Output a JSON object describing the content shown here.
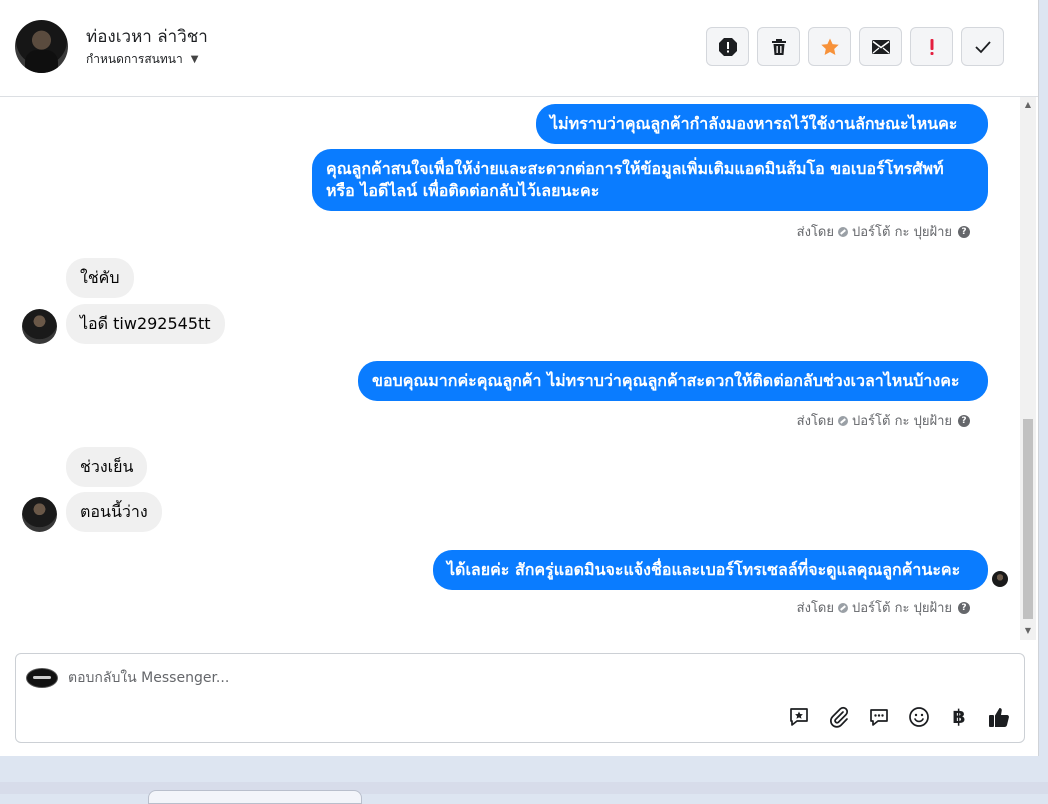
{
  "header": {
    "contact_name": "ท่องเวหา ล่าวิชา",
    "assign_label": "กำหนดการสนทนา",
    "actions": [
      {
        "icon": "alert-circle-icon",
        "color": "#1c1e21"
      },
      {
        "icon": "trash-icon",
        "color": "#1c1e21"
      },
      {
        "icon": "star-icon",
        "color": "#f7923a"
      },
      {
        "icon": "mail-icon",
        "color": "#1c1e21"
      },
      {
        "icon": "exclamation-icon",
        "color": "#e41e3f"
      },
      {
        "icon": "check-icon",
        "color": "#1c1e21"
      }
    ]
  },
  "messages": [
    {
      "direction": "out",
      "text": "ไม่ทราบว่าคุณลูกค้ากำลังมองหารถไว้ใช้งานลักษณะไหนคะ"
    },
    {
      "direction": "out",
      "text": "คุณลูกค้าสนใจเพื่อให้ง่ายและสะดวกต่อการให้ข้อมูลเพิ่มเติมแอดมินส้มโอ ขอเบอร์โทรศัพท์ หรือ ไอดีไลน์ เพื่อติดต่อกลับไว้เลยนะคะ"
    },
    {
      "direction": "in",
      "text": "ใช่คับ"
    },
    {
      "direction": "in",
      "text": "ไอดี tiw292545tt"
    },
    {
      "direction": "out",
      "text": "ขอบคุณมากค่ะคุณลูกค้า ไม่ทราบว่าคุณลูกค้าสะดวกให้ติดต่อกลับช่วงเวลาไหนบ้างคะ"
    },
    {
      "direction": "in",
      "text": "ช่วงเย็น"
    },
    {
      "direction": "in",
      "text": "ตอนนี้ว่าง"
    },
    {
      "direction": "out",
      "text": "ได้เลยค่ะ สักครู่แอดมินจะแจ้งชื่อและเบอร์โทรเซลล์ที่จะดูแลคุณลูกค้านะคะ"
    }
  ],
  "sent_by": {
    "label": "ส่งโดย",
    "name": "ปอร์โต้ กะ ปุยฝ้าย"
  },
  "composer": {
    "placeholder": "ตอบกลับใน Messenger...",
    "tools": [
      "saved-reply-icon",
      "attachment-icon",
      "chat-bubble-icon",
      "emoji-icon",
      "baht-icon",
      "thumbs-up-icon"
    ],
    "baht_symbol": "฿"
  },
  "colors": {
    "outgoing_bubble": "#0a7cff",
    "incoming_bubble": "#f0f0f0"
  }
}
